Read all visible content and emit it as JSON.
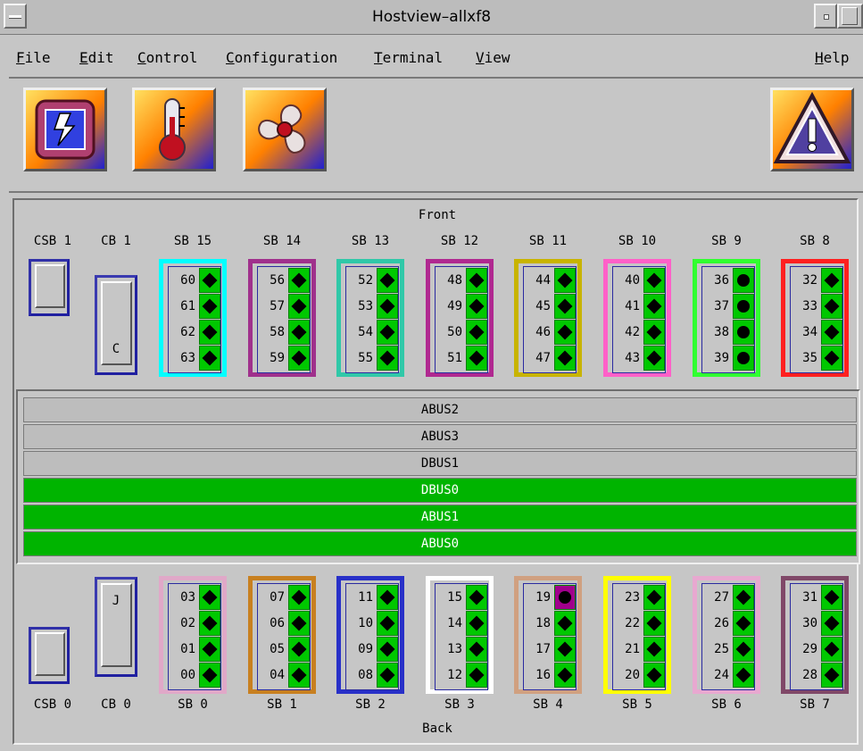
{
  "window": {
    "title": "Hostview–allxf8"
  },
  "menu": {
    "file": {
      "m": "F",
      "rest": "ile"
    },
    "edit": {
      "m": "E",
      "rest": "dit"
    },
    "control": {
      "m": "C",
      "rest": "ontrol"
    },
    "configuration": {
      "m": "C",
      "rest": "onfiguration"
    },
    "terminal": {
      "m": "T",
      "rest": "erminal"
    },
    "view": {
      "m": "V",
      "rest": "iew"
    },
    "help": {
      "m": "H",
      "rest": "elp"
    }
  },
  "toolbar": {
    "power_icon": "power-icon",
    "temperature_icon": "thermometer-icon",
    "fan_icon": "fan-icon",
    "alert_icon": "warning-icon"
  },
  "labels": {
    "front": "Front",
    "back": "Back"
  },
  "front": {
    "csb": "CSB 1",
    "cb": "CB 1",
    "cb_letter": "C",
    "boards": [
      {
        "name": "SB 15",
        "nums": [
          "60",
          "61",
          "62",
          "63"
        ],
        "color": "#00ffff",
        "marker": "diamond"
      },
      {
        "name": "SB 14",
        "nums": [
          "56",
          "57",
          "58",
          "59"
        ],
        "color": "#a0308c",
        "marker": "diamond"
      },
      {
        "name": "SB 13",
        "nums": [
          "52",
          "53",
          "54",
          "55"
        ],
        "color": "#30c8a8",
        "marker": "diamond"
      },
      {
        "name": "SB 12",
        "nums": [
          "48",
          "49",
          "50",
          "51"
        ],
        "color": "#b02890",
        "marker": "diamond"
      },
      {
        "name": "SB 11",
        "nums": [
          "44",
          "45",
          "46",
          "47"
        ],
        "color": "#c8b400",
        "marker": "diamond"
      },
      {
        "name": "SB 10",
        "nums": [
          "40",
          "41",
          "42",
          "43"
        ],
        "color": "#ff60c8",
        "marker": "diamond"
      },
      {
        "name": "SB 9",
        "nums": [
          "36",
          "37",
          "38",
          "39"
        ],
        "color": "#30ff30",
        "marker": "dot"
      },
      {
        "name": "SB 8",
        "nums": [
          "32",
          "33",
          "34",
          "35"
        ],
        "color": "#ff2020",
        "marker": "diamond"
      }
    ]
  },
  "buses": [
    {
      "name": "ABUS2",
      "state": "off"
    },
    {
      "name": "ABUS3",
      "state": "off"
    },
    {
      "name": "DBUS1",
      "state": "off"
    },
    {
      "name": "DBUS0",
      "state": "on"
    },
    {
      "name": "ABUS1",
      "state": "on"
    },
    {
      "name": "ABUS0",
      "state": "on"
    }
  ],
  "back": {
    "csb": "CSB 0",
    "cb": "CB 0",
    "cb_letter": "J",
    "boards": [
      {
        "name": "SB 0",
        "nums": [
          "03",
          "02",
          "01",
          "00"
        ],
        "color": "#e0a8c8",
        "marker": "diamond"
      },
      {
        "name": "SB 1",
        "nums": [
          "07",
          "06",
          "05",
          "04"
        ],
        "color": "#c88020",
        "marker": "diamond"
      },
      {
        "name": "SB 2",
        "nums": [
          "11",
          "10",
          "09",
          "08"
        ],
        "color": "#2830c8",
        "marker": "diamond"
      },
      {
        "name": "SB 3",
        "nums": [
          "15",
          "14",
          "13",
          "12"
        ],
        "color": "#ffffff",
        "marker": "diamond"
      },
      {
        "name": "SB 4",
        "nums": [
          "19",
          "18",
          "17",
          "16"
        ],
        "color": "#d0a080",
        "marker": "diamond",
        "first_marker": "dot-purple"
      },
      {
        "name": "SB 5",
        "nums": [
          "23",
          "22",
          "21",
          "20"
        ],
        "color": "#ffff00",
        "marker": "diamond"
      },
      {
        "name": "SB 6",
        "nums": [
          "27",
          "26",
          "25",
          "24"
        ],
        "color": "#e8a8d0",
        "marker": "diamond"
      },
      {
        "name": "SB 7",
        "nums": [
          "31",
          "30",
          "29",
          "28"
        ],
        "color": "#804868",
        "marker": "diamond"
      }
    ]
  }
}
